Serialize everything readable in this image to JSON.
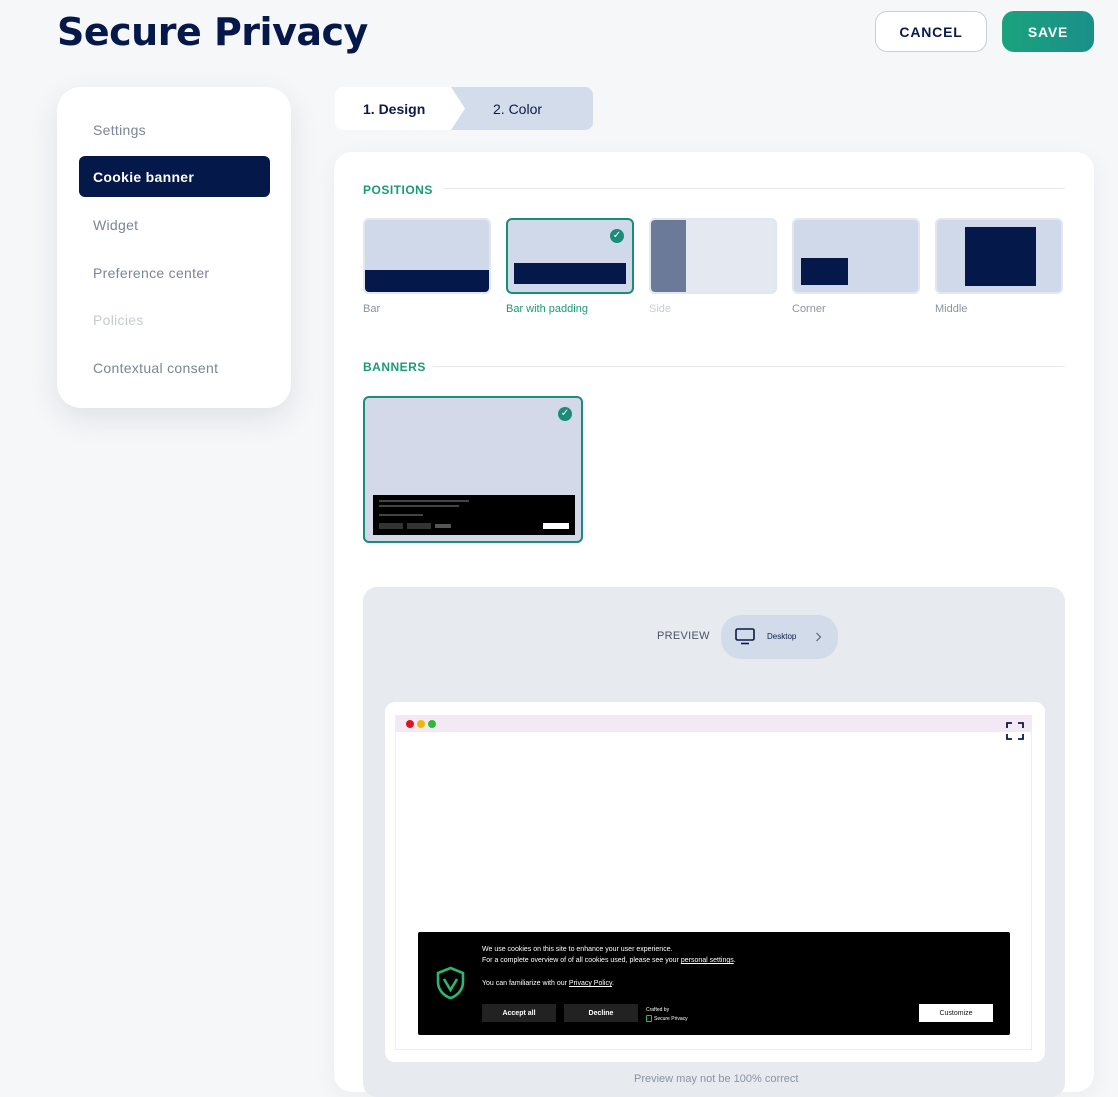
{
  "app": {
    "title": "Secure Privacy",
    "cancel_label": "CANCEL",
    "save_label": "SAVE"
  },
  "sidebar": {
    "items": [
      {
        "label": "Settings",
        "state": "normal"
      },
      {
        "label": "Cookie banner",
        "state": "active"
      },
      {
        "label": "Widget",
        "state": "normal"
      },
      {
        "label": "Preference center",
        "state": "normal"
      },
      {
        "label": "Policies",
        "state": "disabled"
      },
      {
        "label": "Contextual consent",
        "state": "normal"
      }
    ]
  },
  "steps": [
    {
      "label": "1. Design",
      "active": true
    },
    {
      "label": "2. Color",
      "active": false
    }
  ],
  "positions": {
    "heading": "POSITIONS",
    "options": [
      {
        "label": "Bar",
        "selected": false,
        "disabled": false
      },
      {
        "label": "Bar with padding",
        "selected": true,
        "disabled": false
      },
      {
        "label": "Side",
        "selected": false,
        "disabled": true
      },
      {
        "label": "Corner",
        "selected": false,
        "disabled": false
      },
      {
        "label": "Middle",
        "selected": false,
        "disabled": false
      }
    ]
  },
  "banners": {
    "heading": "BANNERS"
  },
  "preview": {
    "label": "PREVIEW",
    "device": "Desktop",
    "footnote": "Preview may not be 100% correct"
  },
  "cookie_banner": {
    "line1": "We use cookies on this site to enhance your user experience.",
    "line2_prefix": "For a complete overview of of all cookies used, please see your ",
    "line2_link": "personal settings",
    "line2_suffix": ".",
    "line3_prefix": "You can familiarize with our ",
    "line3_link": "Privacy Policy",
    "line3_suffix": ".",
    "accept_label": "Accept all",
    "decline_label": "Decline",
    "crafted_by": "Crafted by",
    "brand": "Secure Privacy",
    "customize_label": "Customize"
  },
  "colors": {
    "navy": "#05184a",
    "accent_green": "#1a9b76",
    "card_blue": "#d0d9e9",
    "dot_red": "#e0141e",
    "dot_yellow": "#f2b705",
    "dot_green": "#2fb935"
  },
  "icons": [
    "check-icon",
    "monitor-icon",
    "chevron-right-icon",
    "fullscreen-icon",
    "shield-logo-icon"
  ]
}
